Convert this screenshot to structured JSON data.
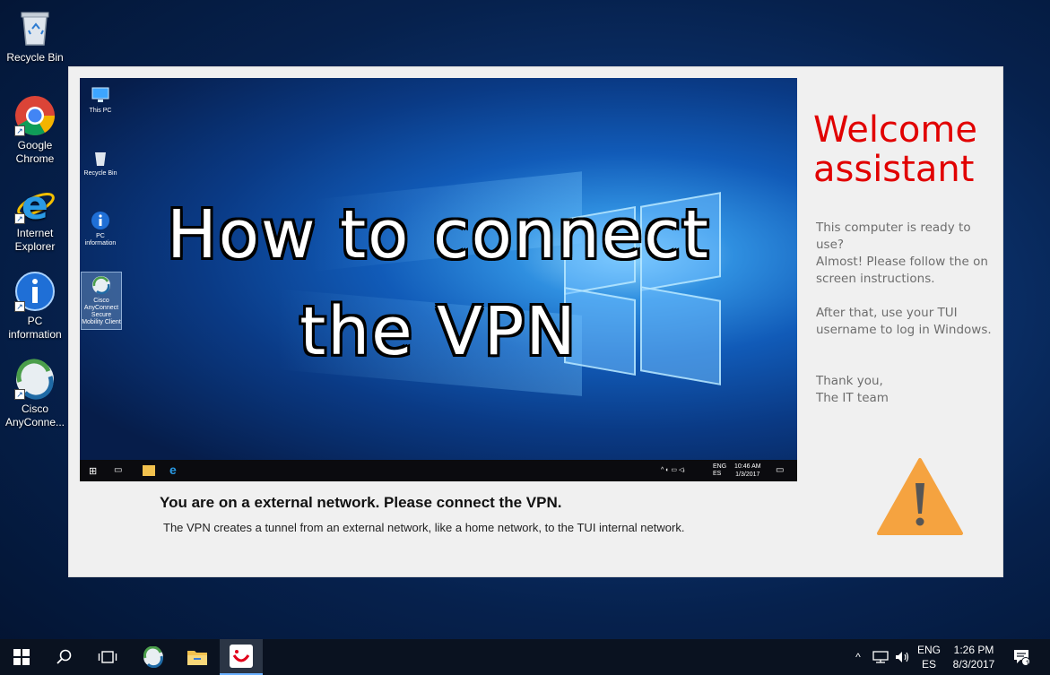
{
  "desktop": {
    "icons": [
      {
        "label": "Recycle Bin",
        "icon": "recycle-bin-icon"
      },
      {
        "label": "Google Chrome",
        "icon": "chrome-icon"
      },
      {
        "label": "Internet Explorer",
        "icon": "internet-explorer-icon"
      },
      {
        "label": "PC information",
        "icon": "info-icon"
      },
      {
        "label": "Cisco AnyConne...",
        "icon": "cisco-anyconnect-icon"
      }
    ]
  },
  "window": {
    "media": {
      "title_line1": "How to connect",
      "title_line2": "the VPN",
      "mini_icons": [
        "This PC",
        "Recycle Bin",
        "PC information",
        "Cisco AnyConnect Secure Mobility Client"
      ],
      "mini_tray": {
        "lang": "ENG ES",
        "time": "10:46 AM",
        "date": "1/3/2017"
      }
    },
    "caption": "You are on a external network. Please connect the VPN.",
    "description": "The VPN creates a tunnel from an external network, like a home network, to the TUI internal network.",
    "side": {
      "heading": "Welcome assistant",
      "p1": "This computer is ready to use?",
      "p2": "Almost! Please follow the on screen instructions.",
      "p3": "After that, use your TUI username to log in Windows.",
      "p4_line1": "Thank you,",
      "p4_line2": "The IT team"
    }
  },
  "taskbar": {
    "buttons": [
      "start-icon",
      "search-icon",
      "task-view-icon",
      "cisco-anyconnect-icon",
      "file-explorer-icon",
      "tui-icon"
    ],
    "lang_top": "ENG",
    "lang_bottom": "ES",
    "time": "1:26 PM",
    "date": "8/3/2017",
    "notification_count": "1"
  },
  "colors": {
    "accent_red": "#e10000",
    "warning_orange": "#f5a340",
    "window_bg": "#f0f0f0"
  }
}
